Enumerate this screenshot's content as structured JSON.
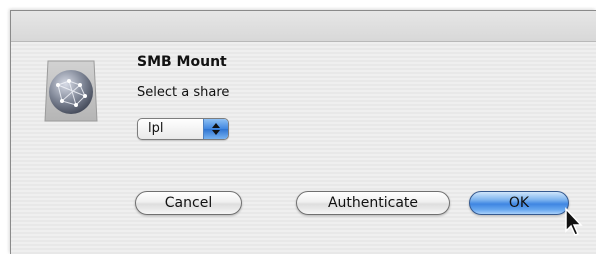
{
  "dialog": {
    "title": "SMB Mount",
    "message": "Select a share",
    "share_select": {
      "selected": "lpl"
    },
    "buttons": {
      "cancel": "Cancel",
      "authenticate": "Authenticate",
      "ok": "OK"
    },
    "icons": {
      "app": "network-globe-icon",
      "cursor": "mouse-pointer-icon",
      "popup": "popup-arrows-icon"
    }
  }
}
